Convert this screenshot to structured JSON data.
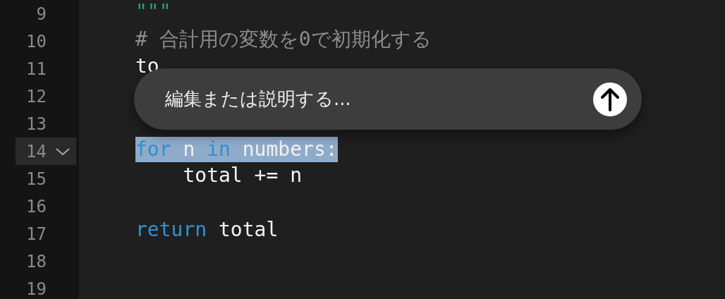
{
  "editor": {
    "lines": [
      {
        "number": "9",
        "selected": false,
        "fold_marker": false,
        "tokens": [
          {
            "kind": "string",
            "text": "\"\"\""
          }
        ]
      },
      {
        "number": "10",
        "selected": false,
        "fold_marker": false,
        "tokens": [
          {
            "kind": "comment",
            "text": "# 合計用の変数を0で初期化する"
          }
        ]
      },
      {
        "number": "11",
        "selected": false,
        "fold_marker": false,
        "tokens": [
          {
            "kind": "plain",
            "text": "to"
          }
        ]
      },
      {
        "number": "12",
        "selected": false,
        "fold_marker": false
      },
      {
        "number": "13",
        "selected": false,
        "fold_marker": false
      },
      {
        "number": "14",
        "selected": true,
        "fold_marker": true,
        "tokens": [
          {
            "kind": "keyword",
            "text": "for"
          },
          {
            "kind": "plain",
            "text": " n "
          },
          {
            "kind": "keyword",
            "text": "in"
          },
          {
            "kind": "plain",
            "text": " numbers:"
          }
        ]
      },
      {
        "number": "15",
        "selected": false,
        "fold_marker": false,
        "tokens": [
          {
            "kind": "plain",
            "text": "    total += n"
          }
        ]
      },
      {
        "number": "16",
        "selected": false,
        "fold_marker": false
      },
      {
        "number": "17",
        "selected": false,
        "fold_marker": false,
        "tokens": [
          {
            "kind": "keyword",
            "text": "return"
          },
          {
            "kind": "plain",
            "text": " total"
          }
        ]
      },
      {
        "number": "18",
        "selected": false,
        "fold_marker": false
      },
      {
        "number": "19",
        "selected": false,
        "fold_marker": false
      }
    ]
  },
  "prompt": {
    "placeholder": "編集または説明する..."
  }
}
